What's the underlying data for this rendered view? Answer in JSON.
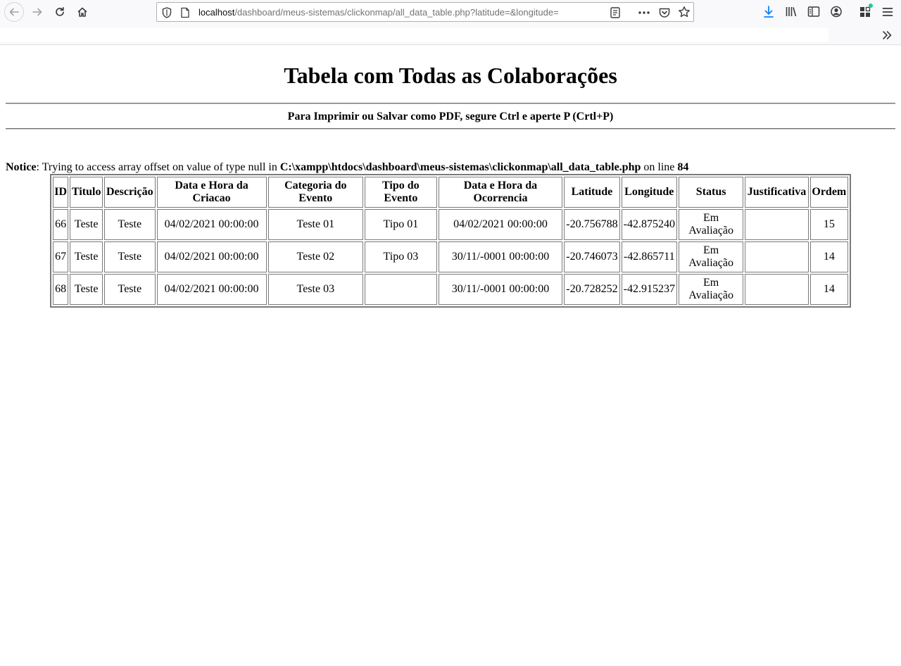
{
  "browser": {
    "url_host": "localhost",
    "url_path": "/dashboard/meus-sistemas/clickonmap/all_data_table.php?latitude=&longitude=",
    "icons": [
      "back-icon",
      "forward-icon",
      "reload-icon",
      "home-icon",
      "shield-icon",
      "page-icon",
      "reader-view-icon",
      "more-icon",
      "pocket-icon",
      "bookmark-star-icon",
      "download-icon",
      "library-icon",
      "sidebar-icon",
      "account-icon",
      "addons-icon",
      "menu-icon",
      "chevrons-icon"
    ],
    "colors": {
      "download_accent": "#0a84ff",
      "notification_dot": "#2ac3a2"
    }
  },
  "page": {
    "title": "Tabela com Todas as Colaborações",
    "subtitle": "Para Imprimir ou Salvar como PDF, segure Ctrl e aperte P (Crtl+P)",
    "notice": {
      "label": "Notice",
      "message": ": Trying to access array offset on value of type null in ",
      "file": "C:\\xampp\\htdocs\\dashboard\\meus-sistemas\\clickonmap\\all_data_table.php",
      "line_text": " on line ",
      "line": "84"
    }
  },
  "table": {
    "headers": [
      "ID",
      "Titulo",
      "Descrição",
      "Data e Hora da Criacao",
      "Categoria do Evento",
      "Tipo do Evento",
      "Data e Hora da Ocorrencia",
      "Latitude",
      "Longitude",
      "Status",
      "Justificativa",
      "Ordem"
    ],
    "rows": [
      [
        "66",
        "Teste",
        "Teste",
        "04/02/2021 00:00:00",
        "Teste 01",
        "Tipo 01",
        "04/02/2021 00:00:00",
        "-20.756788",
        "-42.875240",
        "Em Avaliação",
        "",
        "15"
      ],
      [
        "67",
        "Teste",
        "Teste",
        "04/02/2021 00:00:00",
        "Teste 02",
        "Tipo 03",
        "30/11/-0001 00:00:00",
        "-20.746073",
        "-42.865711",
        "Em Avaliação",
        "",
        "14"
      ],
      [
        "68",
        "Teste",
        "Teste",
        "04/02/2021 00:00:00",
        "Teste 03",
        "",
        "30/11/-0001 00:00:00",
        "-20.728252",
        "-42.915237",
        "Em Avaliação",
        "",
        "14"
      ]
    ]
  }
}
